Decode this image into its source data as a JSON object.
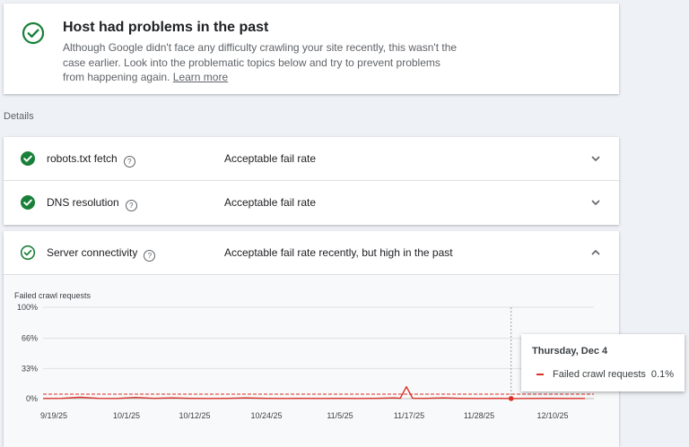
{
  "summary": {
    "title": "Host had problems in the past",
    "text": "Although Google didn't face any difficulty crawling your site recently, this wasn't the case earlier. Look into the problematic topics below and try to prevent problems from happening again.",
    "learn_more": "Learn more",
    "icon": "check-circle-icon"
  },
  "details_label": "Details",
  "rows": [
    {
      "name": "robots.txt fetch",
      "status": "Acceptable fail rate",
      "icon": "check-circle-filled-icon"
    },
    {
      "name": "DNS resolution",
      "status": "Acceptable fail rate",
      "icon": "check-circle-filled-icon"
    },
    {
      "name": "Server connectivity",
      "status": "Acceptable fail rate recently, but high in the past",
      "icon": "check-circle-outline-icon"
    }
  ],
  "help_glyph": "?",
  "colors": {
    "green": "#188038",
    "series": "#d93025",
    "grid": "#e0e0e0"
  },
  "chart_data": {
    "type": "line",
    "title": "Failed crawl requests",
    "yticks": [
      "100%",
      "66%",
      "33%",
      "0%"
    ],
    "xticks": [
      "9/19/25",
      "10/1/25",
      "10/12/25",
      "10/24/25",
      "11/5/25",
      "11/17/25",
      "11/28/25",
      "12/10/25"
    ],
    "ylim": [
      0,
      100
    ],
    "series": [
      {
        "name": "Failed crawl requests",
        "x": [
          "9/19/25",
          "9/22/25",
          "9/25/25",
          "9/28/25",
          "10/1/25",
          "10/4/25",
          "10/7/25",
          "10/10/25",
          "10/13/25",
          "10/16/25",
          "10/19/25",
          "10/22/25",
          "10/25/25",
          "10/28/25",
          "10/31/25",
          "11/3/25",
          "11/6/25",
          "11/9/25",
          "11/12/25",
          "11/15/25",
          "11/16/25",
          "11/17/25",
          "11/18/25",
          "11/20/25",
          "11/23/25",
          "11/26/25",
          "11/29/25",
          "12/2/25",
          "12/4/25",
          "12/7/25",
          "12/10/25",
          "12/13/25",
          "12/16/25"
        ],
        "values": [
          0.2,
          0.3,
          1.5,
          0.3,
          0.2,
          1.3,
          0.3,
          0.8,
          0.3,
          0.2,
          0.3,
          0.8,
          0.3,
          0.2,
          0.3,
          0.2,
          0.3,
          0.2,
          0.3,
          0.8,
          0.4,
          13,
          0.4,
          0.3,
          0.8,
          0.3,
          0.2,
          0.3,
          0.1,
          0.2,
          0.3,
          0.2,
          0.2
        ]
      }
    ],
    "threshold_line": true,
    "hover_date": "12/4/25"
  },
  "tooltip": {
    "date": "Thursday, Dec 4",
    "label": "Failed crawl requests",
    "value": "0.1%"
  }
}
